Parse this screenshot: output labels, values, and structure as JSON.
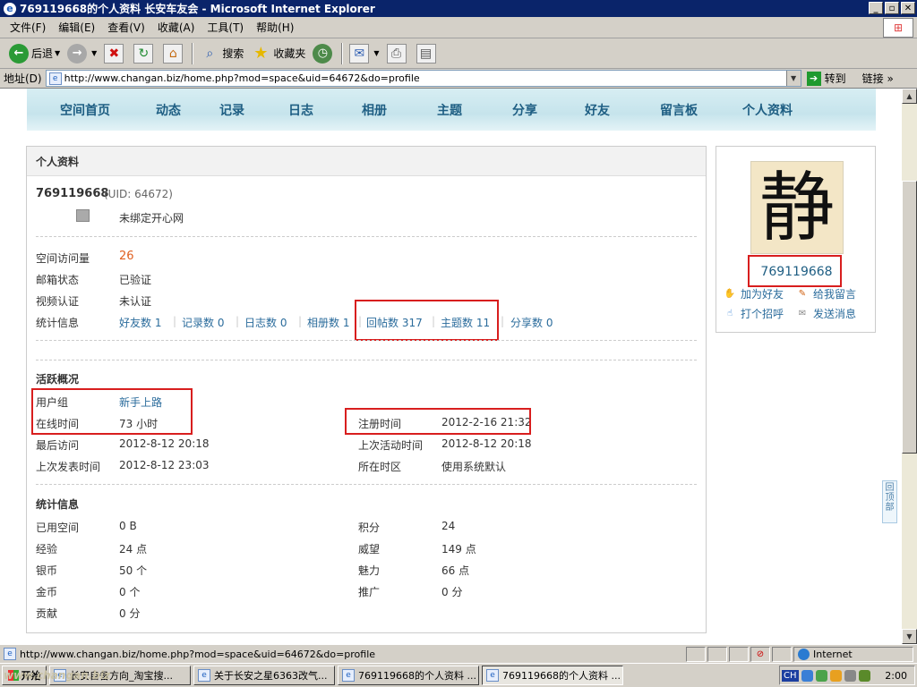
{
  "window": {
    "title": "769119668的个人资料 长安车友会 - Microsoft Internet Explorer",
    "controls": [
      "_",
      "▫",
      "✕"
    ]
  },
  "menubar": {
    "items": [
      "文件(F)",
      "编辑(E)",
      "查看(V)",
      "收藏(A)",
      "工具(T)",
      "帮助(H)"
    ]
  },
  "toolbar": {
    "back": "后退",
    "search": "搜索",
    "favorites": "收藏夹"
  },
  "addressbar": {
    "label": "地址(D)",
    "url": "http://www.changan.biz/home.php?mod=space&uid=64672&do=profile",
    "go": "转到",
    "links": "链接"
  },
  "nav": {
    "items": [
      "空间首页",
      "动态",
      "记录",
      "日志",
      "相册",
      "主题",
      "分享",
      "好友",
      "留言板",
      "个人资料"
    ]
  },
  "profile": {
    "panel_title": "个人资料",
    "username": "769119668",
    "uid": "(UID: 64672)",
    "kaixin": "未绑定开心网",
    "visits_label": "空间访问量",
    "visits_value": "26",
    "email_label": "邮箱状态",
    "email_value": "已验证",
    "video_label": "视频认证",
    "video_value": "未认证",
    "stats_label": "统计信息",
    "stats": [
      "好友数 1",
      "记录数 0",
      "日志数 0",
      "相册数 1",
      "回帖数 317",
      "主题数 11",
      "分享数 0"
    ],
    "activity_title": "活跃概况",
    "usergroup_label": "用户组",
    "usergroup_value": "新手上路",
    "online_label": "在线时间",
    "online_value": "73 小时",
    "reg_label": "注册时间",
    "reg_value": "2012-2-16 21:32",
    "lastvisit_label": "最后访问",
    "lastvisit_value": "2012-8-12 20:18",
    "lastactive_label": "上次活动时间",
    "lastactive_value": "2012-8-12 20:18",
    "lastpost_label": "上次发表时间",
    "lastpost_value": "2012-8-12 23:03",
    "tz_label": "所在时区",
    "tz_value": "使用系统默认",
    "stats_title": "统计信息",
    "space_label": "已用空间",
    "space_value": "0 B",
    "points_label": "积分",
    "points_value": "24",
    "exp_label": "经验",
    "exp_value": "24 点",
    "prestige_label": "威望",
    "prestige_value": "149 点",
    "silver_label": "银币",
    "silver_value": "50 个",
    "charm_label": "魅力",
    "charm_value": "66 点",
    "gold_label": "金币",
    "gold_value": "0 个",
    "promo_label": "推广",
    "promo_value": "0 分",
    "contrib_label": "贡献",
    "contrib_value": "0 分"
  },
  "side": {
    "avatar_char": "静",
    "username": "769119668",
    "add_friend": "加为好友",
    "leave_msg": "给我留言",
    "poke": "打个招呼",
    "send_msg": "发送消息"
  },
  "backtop": "回顶部",
  "statusbar": {
    "url": "http://www.changan.biz/home.php?mod=space&uid=64672&do=profile",
    "zone": "Internet"
  },
  "taskbar": {
    "start": "开始",
    "tasks": [
      "长安自备方向_淘宝搜...",
      "关于长安之星6363改气...",
      "769119668的个人资料 ...",
      "769119668的个人资料 ..."
    ],
    "ime": "CH",
    "clock": "2:00"
  },
  "watermark": "www.changan.biz"
}
